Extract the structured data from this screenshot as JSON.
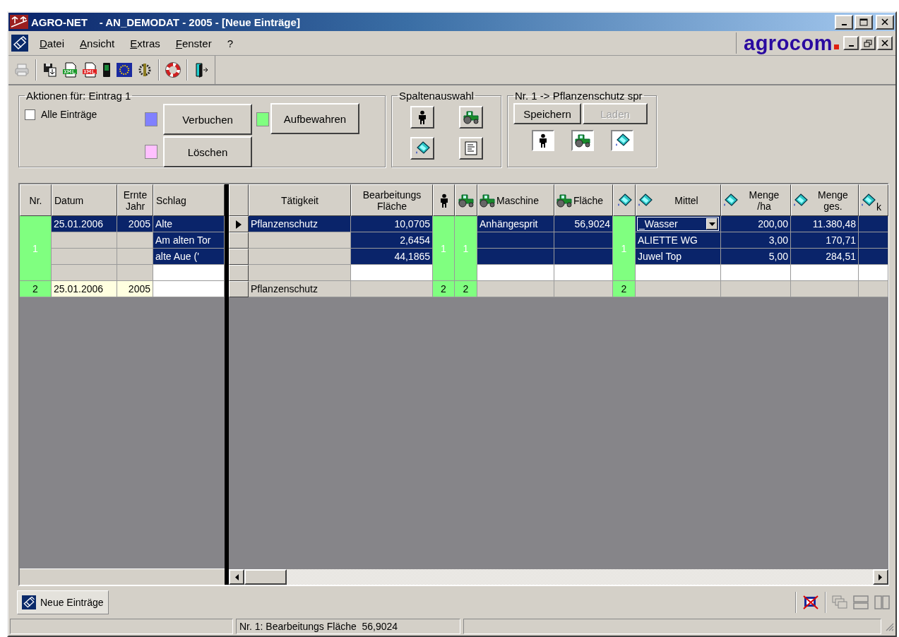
{
  "window": {
    "title": "AGRO-NET    - AN_DEMODAT - 2005 - [Neue Einträge]"
  },
  "menu": [
    {
      "label": "Datei"
    },
    {
      "label": "Ansicht"
    },
    {
      "label": "Extras"
    },
    {
      "label": "Fenster"
    },
    {
      "label": "?"
    }
  ],
  "logo": "agrocom",
  "actions": {
    "legend": "Aktionen für: Eintrag 1",
    "all_entries": {
      "label": "Alle Einträge",
      "checked": false
    },
    "buttons": [
      {
        "label": "Verbuchen",
        "color": "#8080ff"
      },
      {
        "label": "Aufbewahren",
        "color": "#80ff80"
      },
      {
        "label": "Löschen",
        "color": "#ffc0ff"
      }
    ]
  },
  "column_choice": {
    "legend": "Spaltenauswahl"
  },
  "template": {
    "legend": "Nr. 1 -> Pflanzenschutz spr",
    "buttons": [
      {
        "label": "Speichern",
        "disabled": false
      },
      {
        "label": "Laden",
        "disabled": true
      }
    ]
  },
  "grid": {
    "columns": {
      "nr": "Nr.",
      "datum": "Datum",
      "jahr": "Ernte\nJahr",
      "schlag": "Schlag",
      "taetigkeit": "Tätigkeit",
      "flaeche": "Bearbeitungs\nFläche",
      "maschine": "Maschine",
      "maschine_flaeche": "Fläche",
      "mittel": "Mittel",
      "menge_ha": "Menge\n/ha",
      "menge_ges": "Menge\nges.",
      "column_16": "k"
    },
    "entries": [
      {
        "nr": "1",
        "selected": true,
        "expanded": true,
        "person": "1",
        "tractor": "1",
        "spray": "1",
        "rows": [
          {
            "selected": true,
            "current": true,
            "datum": "25.01.2006",
            "jahr": "2005",
            "schlag": "Alte",
            "taetigkeit": "Pflanzenschutz",
            "flaeche": "10,0705",
            "maschine": "Anhängesprit",
            "maschine_flaeche": "56,9024",
            "mittel": "_Wasser",
            "dropdown": true,
            "menge_ha": "200,00",
            "menge_ges": "11.380,48"
          },
          {
            "selected": true,
            "current": false,
            "schlag": "Am alten Tor",
            "flaeche": "2,6454",
            "mittel": "ALIETTE WG",
            "dropdown": false,
            "menge_ha": "3,00",
            "menge_ges": "170,71"
          },
          {
            "selected": true,
            "current": false,
            "schlag": "alte Aue ('",
            "flaeche": "44,1865",
            "mittel": "Juwel Top",
            "dropdown": false,
            "menge_ha": "5,00",
            "menge_ges": "284,51"
          },
          {
            "selected": false,
            "current": false,
            "dropdown": false
          }
        ]
      },
      {
        "nr": "2",
        "selected": false,
        "expanded": false,
        "person": "2",
        "tractor": "2",
        "spray": "2",
        "rows": [
          {
            "selected": false,
            "current": false,
            "dropdown": false,
            "datum": "25.01.2006",
            "jahr": "2005",
            "taetigkeit": "Pflanzenschutz"
          }
        ]
      }
    ]
  },
  "taskbar": {
    "items": [
      {
        "label": "Neue Einträge",
        "selected": true
      }
    ]
  },
  "status_bar": {
    "panel_2": "Nr. 1: Bearbeitungs Fläche  56,9024"
  }
}
